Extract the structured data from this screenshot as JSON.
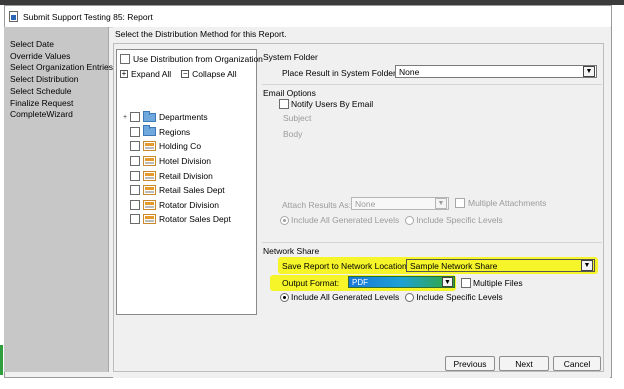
{
  "window": {
    "title": "Submit Support Testing 85: Report"
  },
  "sidebar": {
    "items": [
      {
        "label": "Select Date"
      },
      {
        "label": "Override Values"
      },
      {
        "label": "Select Organization Entries"
      },
      {
        "label": "Select Distribution"
      },
      {
        "label": "Select Schedule"
      },
      {
        "label": "Finalize Request"
      },
      {
        "label": "CompleteWizard"
      }
    ]
  },
  "main": {
    "instruction": "Select the Distribution Method for this Report."
  },
  "distribution": {
    "use_org_label": "Use Distribution from Organization",
    "expand_all": "Expand All",
    "collapse_all": "Collapse All",
    "expand_symbol": "+",
    "collapse_symbol": "−",
    "tree": [
      {
        "label": "Departments",
        "icon": "folder-icon",
        "expandable": true
      },
      {
        "label": "Regions",
        "icon": "folder-icon",
        "expandable": false
      },
      {
        "label": "Holding Co",
        "icon": "org-unit-icon",
        "expandable": false
      },
      {
        "label": "Hotel Division",
        "icon": "org-unit-icon",
        "expandable": false
      },
      {
        "label": "Retail Division",
        "icon": "org-unit-icon",
        "expandable": false
      },
      {
        "label": "Retail Sales Dept",
        "icon": "org-unit-icon",
        "expandable": false
      },
      {
        "label": "Rotator Division",
        "icon": "org-unit-icon",
        "expandable": false
      },
      {
        "label": "Rotator Sales Dept",
        "icon": "org-unit-icon",
        "expandable": false
      }
    ]
  },
  "system_folder": {
    "title": "System Folder",
    "place_label": "Place Result in System Folder:",
    "place_value": "None"
  },
  "email": {
    "title": "Email Options",
    "notify_label": "Notify Users By Email",
    "subject_label": "Subject",
    "body_label": "Body",
    "attach_label": "Attach Results As:",
    "attach_value": "None",
    "multiple_attachments_label": "Multiple Attachments",
    "include_all_label": "Include All Generated Levels",
    "include_specific_label": "Include Specific Levels"
  },
  "network_share": {
    "title": "Network Share",
    "save_label": "Save Report to Network Location:",
    "save_value": "Sample Network Share",
    "output_label": "Output Format:",
    "output_value": "PDF",
    "multiple_files_label": "Multiple Files",
    "include_all_label": "Include All Generated Levels",
    "include_specific_label": "Include Specific Levels"
  },
  "buttons": {
    "previous": "Previous",
    "next": "Next",
    "cancel": "Cancel"
  },
  "colors": {
    "highlight": "#f5f52a",
    "sidebar": "#c7c7c7",
    "dialog": "#f0f0f0"
  },
  "icons": {
    "dropdown": "▼"
  }
}
